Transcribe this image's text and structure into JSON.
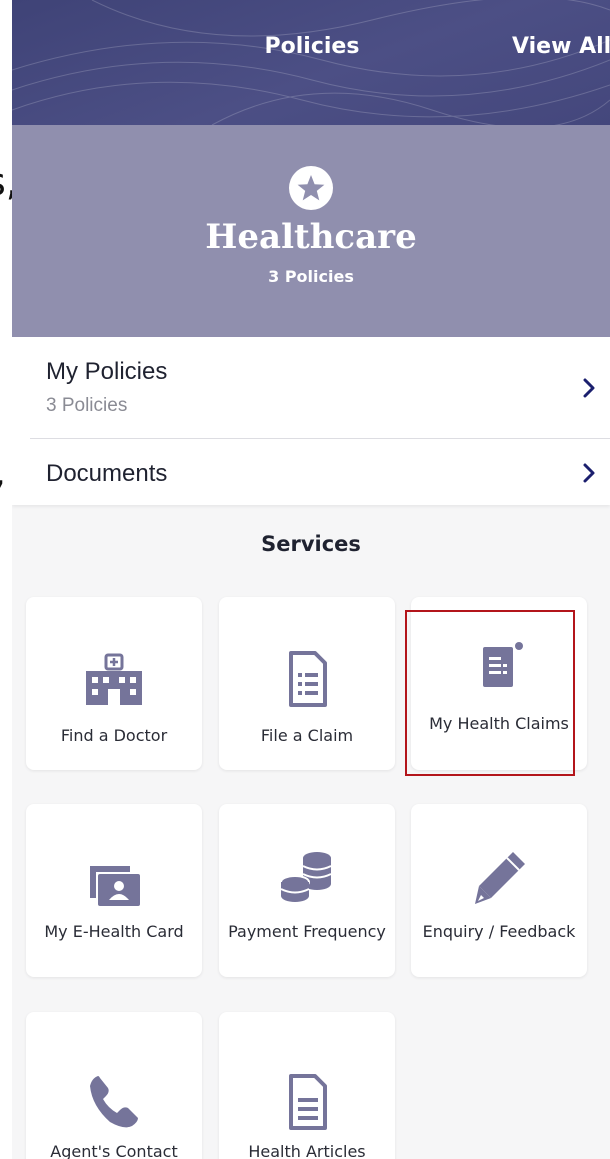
{
  "header": {
    "title": "Policies",
    "view_all": "View All"
  },
  "hero": {
    "icon": "star-circle-icon",
    "title": "Healthcare",
    "subtitle": "3 Policies"
  },
  "list": [
    {
      "label": "My Policies",
      "sub": "3 Policies"
    },
    {
      "label": "Documents"
    }
  ],
  "services": {
    "title": "Services",
    "tiles": [
      {
        "label": "Find a Doctor",
        "icon": "hospital-icon"
      },
      {
        "label": "File a Claim",
        "icon": "document-list-icon"
      },
      {
        "label": "My Health Claims",
        "icon": "claims-document-icon"
      },
      {
        "label": "My E-Health Card",
        "icon": "id-card-icon"
      },
      {
        "label": "Payment Frequency",
        "icon": "coins-icon"
      },
      {
        "label": "Enquiry / Feedback",
        "icon": "pencil-icon"
      },
      {
        "label": "Agent's Contact",
        "icon": "phone-icon"
      },
      {
        "label": "Health Articles",
        "icon": "article-icon"
      }
    ]
  },
  "colors": {
    "header": "#44477c",
    "hero": "#908fae",
    "icon": "#75749a",
    "chevron": "#1b1f6e",
    "highlight": "#b3151b"
  }
}
